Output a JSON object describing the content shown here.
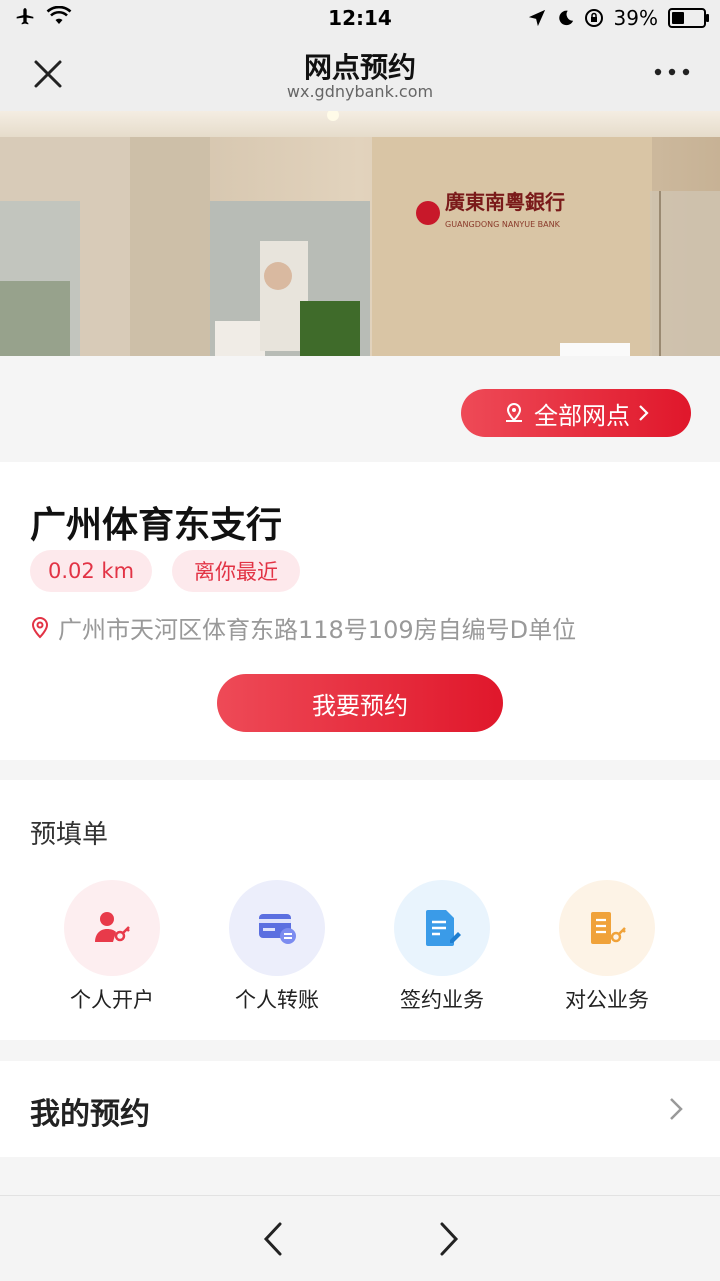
{
  "status_bar": {
    "time": "12:14",
    "battery_text": "39%",
    "battery_level": 0.39,
    "icons": [
      "airplane-icon",
      "wifi-icon",
      "location-arrow-icon",
      "moon-icon",
      "rotation-lock-icon",
      "battery-icon"
    ]
  },
  "nav": {
    "title": "网点预约",
    "subtitle": "wx.gdnybank.com",
    "icons": [
      "close-icon",
      "more-icon"
    ]
  },
  "banner": {
    "logo_text": "廣東南粵銀行",
    "logo_sub": "GUANGDONG NANYUE BANK"
  },
  "all_outlets": {
    "label": "全部网点"
  },
  "branch": {
    "name": "广州体育东支行",
    "distance": "0.02 km",
    "nearest_tag": "离你最近",
    "address": "广州市天河区体育东路118号109房自编号D单位",
    "book_button": "我要预约"
  },
  "prefill": {
    "title": "预填单",
    "items": [
      {
        "label": "个人开户",
        "icon": "person-key-icon",
        "bg": "#fdeef0",
        "color": "#e83a4a"
      },
      {
        "label": "个人转账",
        "icon": "card-transfer-icon",
        "bg": "#eceefb",
        "color": "#5b6fe0"
      },
      {
        "label": "签约业务",
        "icon": "document-sign-icon",
        "bg": "#e9f4fd",
        "color": "#3a9be8"
      },
      {
        "label": "对公业务",
        "icon": "building-key-icon",
        "bg": "#fdf3e6",
        "color": "#f0a23a"
      }
    ]
  },
  "my_booking": {
    "title": "我的预约"
  },
  "colors": {
    "brand_red": "#e0172b",
    "tag_bg": "#fde9ec"
  }
}
